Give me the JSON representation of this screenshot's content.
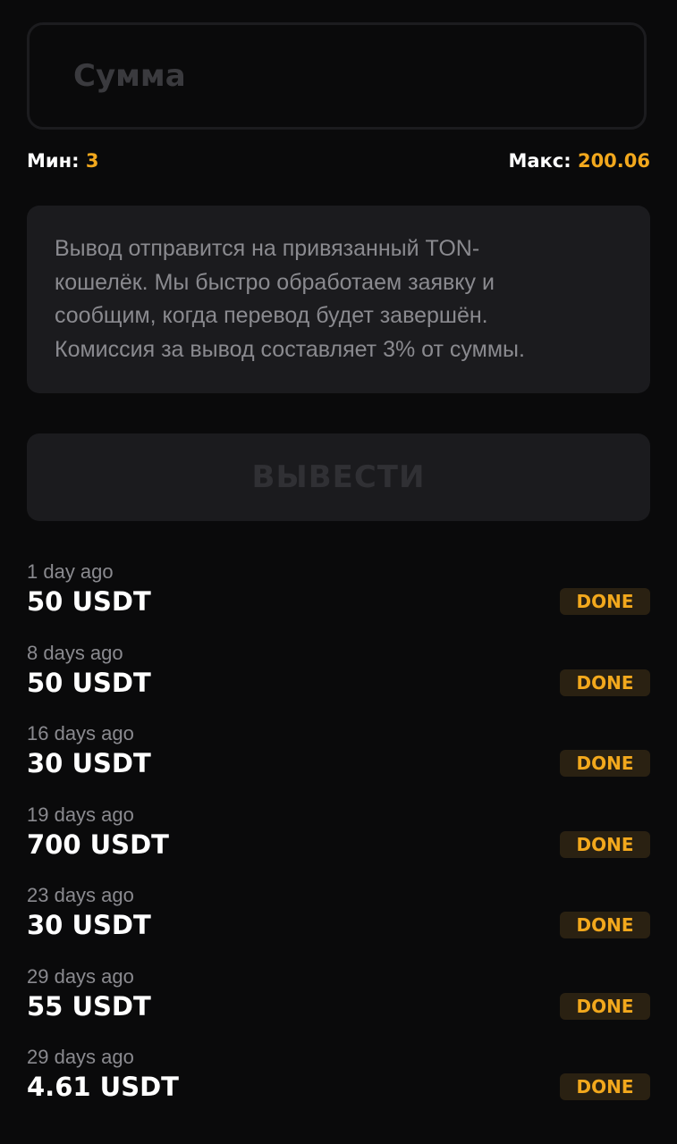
{
  "amount_field": {
    "placeholder": "Сумма"
  },
  "limits": {
    "min_label": "Мин:",
    "min_value": "3",
    "max_label": "Макс:",
    "max_value": "200.06"
  },
  "info": {
    "lines": [
      "Вывод отправится на привязанный TON-",
      "кошелёк. Мы быстро обработаем заявку и",
      "сообщим, когда перевод будет завершён.",
      "Комиссия за вывод составляет 3% от суммы."
    ]
  },
  "withdraw_button": {
    "label": "ВЫВЕСТИ"
  },
  "history": [
    {
      "when": "1 day ago",
      "amount": "50 USDT",
      "status": "DONE"
    },
    {
      "when": "8 days ago",
      "amount": "50 USDT",
      "status": "DONE"
    },
    {
      "when": "16 days ago",
      "amount": "30 USDT",
      "status": "DONE"
    },
    {
      "when": "19 days ago",
      "amount": "700 USDT",
      "status": "DONE"
    },
    {
      "when": "23 days ago",
      "amount": "30 USDT",
      "status": "DONE"
    },
    {
      "when": "29 days ago",
      "amount": "55 USDT",
      "status": "DONE"
    },
    {
      "when": "29 days ago",
      "amount": "4.61 USDT",
      "status": "DONE"
    }
  ],
  "colors": {
    "background": "#0a0a0b",
    "accent": "#f2a81d",
    "card": "#1b1b1e",
    "muted_text": "#8a8a8f",
    "disabled_text": "#303034",
    "badge_bg": "#2a2112"
  }
}
